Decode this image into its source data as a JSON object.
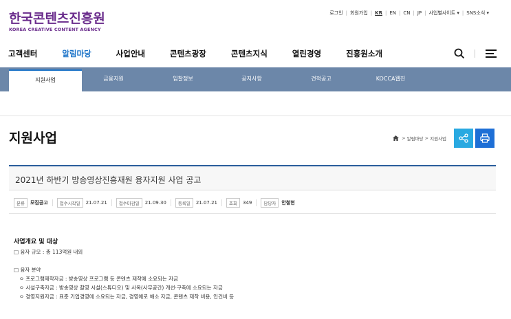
{
  "header": {
    "logo_ko": "한국콘텐츠진흥원",
    "logo_en": "KOREA CREATIVE CONTENT AGENCY",
    "util": [
      "로그인",
      "회원가입",
      "KR",
      "EN",
      "CN",
      "JP",
      "사업별사이트 ▾",
      "SNS소식 ▾"
    ]
  },
  "gnb": [
    "고객센터",
    "알림마당",
    "사업안내",
    "콘텐츠광장",
    "콘텐츠지식",
    "열린경영",
    "진흥원소개"
  ],
  "subnav": [
    "지원사업",
    "금융지원",
    "입찰정보",
    "공지사항",
    "견적공고",
    "KOCCA웹진"
  ],
  "page": {
    "title": "지원사업",
    "breadcrumb": [
      "알림마당",
      "지원사업"
    ]
  },
  "article": {
    "title": "2021년 하반기 방송영상진흥재원 융자지원 사업 공고",
    "meta": [
      {
        "label": "분류",
        "value": "모집공고"
      },
      {
        "label": "접수시작일",
        "value": "21.07.21"
      },
      {
        "label": "접수마감일",
        "value": "21.09.30"
      },
      {
        "label": "등록일",
        "value": "21.07.21"
      },
      {
        "label": "조회",
        "value": "349"
      },
      {
        "label": "담당자",
        "value": "안철현"
      }
    ],
    "section_title": "사업개요 및 대상",
    "scale": "□ 융자 규모 : 총 113억원 내외",
    "field_title": "□ 융자 분야",
    "items": [
      "ㅇ 프로그램제작자금 : 방송영상 프로그램 등 콘텐츠 제작에 소요되는 자금",
      "ㅇ 시설구축자금 : 방송영상 촬영 시설(스튜디오) 및 사옥(사무공간) 개선·구축에 소요되는 자금",
      "ㅇ 경영지원자금 : 표준 기업경영에 소요되는 자금, 경영애로 해소 자금, 콘텐츠 제작 비용, 인건비 등"
    ]
  },
  "colors": {
    "brand": "#6a2c8c",
    "accent": "#1e75c9",
    "subnav": "#6c87a9",
    "share": "#29a9e1",
    "print": "#1e6fd6"
  }
}
